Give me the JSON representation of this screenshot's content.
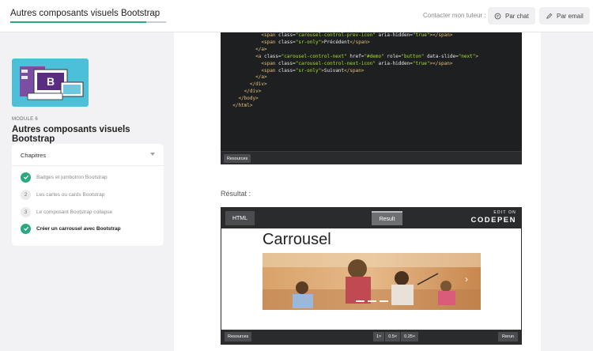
{
  "header": {
    "course_title": "Autres composants visuels Bootstrap",
    "contact_label": "Contacter mon tuteur :",
    "chat_label": "Par chat",
    "email_label": "Par email"
  },
  "sidebar": {
    "module_label": "MODULE 6",
    "module_title": "Autres composants visuels Bootstrap",
    "chapters_label": "Chapitres",
    "chapters": [
      {
        "marker": "✓",
        "label": "Badges et jumbotron Bootstrap",
        "status": "done"
      },
      {
        "marker": "2",
        "label": "Les cartes ou cards Bootstrap",
        "status": "todo"
      },
      {
        "marker": "3",
        "label": "Le composant Bootstrap collapse",
        "status": "todo"
      },
      {
        "marker": "✓",
        "label": "Créer un carrousel avec Bootstrap",
        "status": "current"
      }
    ]
  },
  "code_embed": {
    "lines": [
      {
        "indent": "            ",
        "parts": [
          [
            "tg",
            "<span "
          ],
          [
            "at",
            "class="
          ],
          [
            "st",
            "\"carousel-control-prev-icon\""
          ],
          [
            "at",
            " aria-hidden="
          ],
          [
            "st",
            "\"true\""
          ],
          [
            "tg",
            "></span>"
          ]
        ]
      },
      {
        "indent": "            ",
        "parts": [
          [
            "tg",
            "<span "
          ],
          [
            "at",
            "class="
          ],
          [
            "st",
            "\"sr-only\""
          ],
          [
            "tg",
            ">"
          ],
          [
            "at",
            "Précédent"
          ],
          [
            "tg",
            "</span>"
          ]
        ]
      },
      {
        "indent": "          ",
        "parts": [
          [
            "tg",
            "</a>"
          ]
        ]
      },
      {
        "indent": "          ",
        "parts": [
          [
            "tg",
            "<a "
          ],
          [
            "at",
            "class="
          ],
          [
            "st",
            "\"carousel-control-next\""
          ],
          [
            "at",
            " href="
          ],
          [
            "st",
            "\"#demo\""
          ],
          [
            "at",
            " role="
          ],
          [
            "st",
            "\"button\""
          ],
          [
            "at",
            " data-slide="
          ],
          [
            "st",
            "\"next\""
          ],
          [
            "tg",
            ">"
          ]
        ]
      },
      {
        "indent": "            ",
        "parts": [
          [
            "tg",
            "<span "
          ],
          [
            "at",
            "class="
          ],
          [
            "st",
            "\"carousel-control-next-icon\""
          ],
          [
            "at",
            " aria-hidden="
          ],
          [
            "st",
            "\"true\""
          ],
          [
            "tg",
            "></span>"
          ]
        ]
      },
      {
        "indent": "            ",
        "parts": [
          [
            "tg",
            "<span "
          ],
          [
            "at",
            "class="
          ],
          [
            "st",
            "\"sr-only\""
          ],
          [
            "tg",
            ">"
          ],
          [
            "at",
            "Suivant"
          ],
          [
            "tg",
            "</span>"
          ]
        ]
      },
      {
        "indent": "          ",
        "parts": [
          [
            "tg",
            "</a>"
          ]
        ]
      },
      {
        "indent": "        ",
        "parts": [
          [
            "tg",
            "</div>"
          ]
        ]
      },
      {
        "indent": "      ",
        "parts": [
          [
            "tg",
            "</div>"
          ]
        ]
      },
      {
        "indent": "    ",
        "parts": [
          [
            "tg",
            "</body>"
          ]
        ]
      },
      {
        "indent": "  ",
        "parts": [
          [
            "tg",
            "</html>"
          ]
        ]
      }
    ],
    "resources_label": "Resources"
  },
  "result": {
    "label": "Résultat :",
    "tab_html": "HTML",
    "tab_result": "Result",
    "codepen_edit": "EDIT ON",
    "codepen_name": "CODEPEN",
    "carousel_title": "Carrousel",
    "carousel_arrow": "›",
    "resources_label": "Resources",
    "zoom": [
      "1×",
      "0.5×",
      "0.25×"
    ],
    "rerun_label": "Rerun"
  },
  "colors": {
    "accent": "#2aa882",
    "code_bg": "#1e1f21",
    "thumb_bg": "#4bc0d8"
  }
}
